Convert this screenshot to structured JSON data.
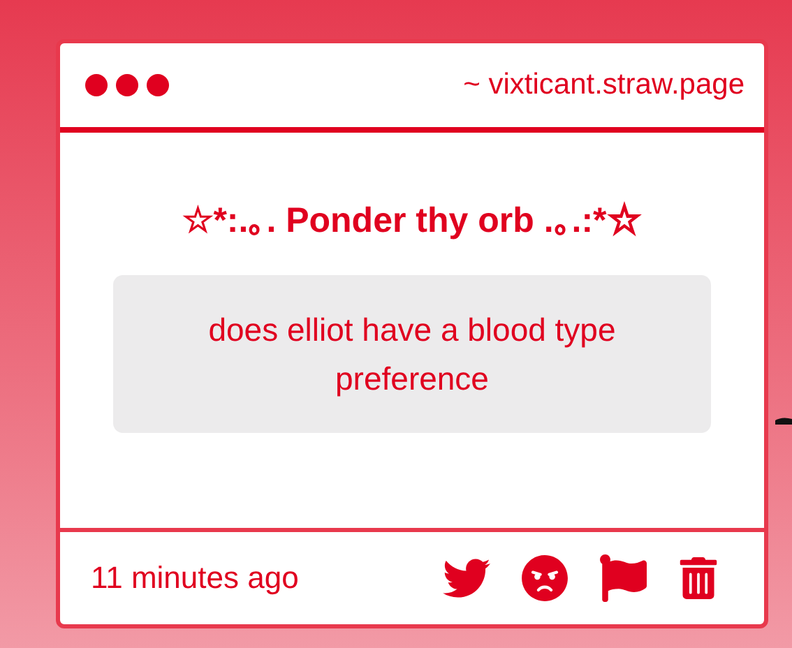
{
  "window": {
    "address": "~ vixticant.straw.page"
  },
  "card": {
    "title": "☆*:.｡. Ponder thy orb .｡.:*☆",
    "question": "does elliot have a blood type preference"
  },
  "footer": {
    "time": "11 minutes ago",
    "actions": [
      {
        "kind": "share"
      },
      {
        "kind": "angry"
      },
      {
        "kind": "report"
      },
      {
        "kind": "delete"
      }
    ]
  }
}
